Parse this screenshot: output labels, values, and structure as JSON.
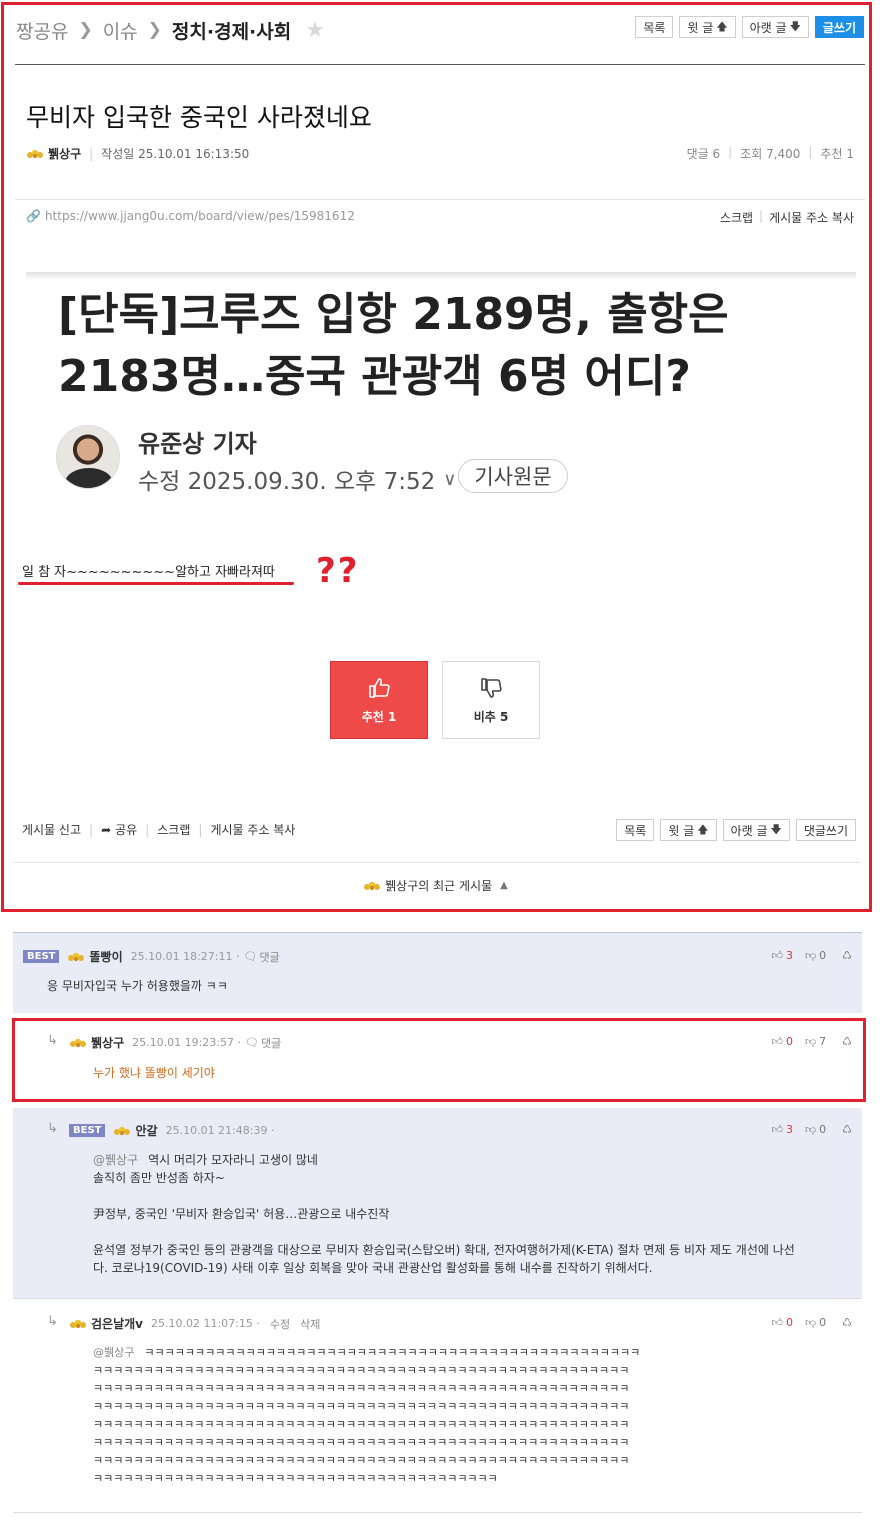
{
  "breadcrumb": [
    "짱공유",
    "이슈",
    "정치·경제·사회"
  ],
  "top_buttons": {
    "list": "목록",
    "prev": "윗 글",
    "next": "아랫 글",
    "write": "글쓰기"
  },
  "post": {
    "title": "무비자 입국한 중국인 사라졌네요",
    "author": "뷁상구",
    "date_label": "작성일 25.10.01 16:13:50",
    "comments": "댓글 6",
    "views": "조회 7,400",
    "recommends": "추천 1",
    "url": "https://www.jjang0u.com/board/view/pes/15981612",
    "scrap": "스크랩",
    "copy_url": "게시물 주소 복사",
    "body_text": "일 참 자~~~~~~~~~~알하고 자빠라져따",
    "annotation": "??"
  },
  "article_image": {
    "headline_1": "[단독]크루즈 입항 2189명, 출항은",
    "headline_2": "2183명…중국 관광객 6명 어디?",
    "reporter": "유준상 기자",
    "date": "수정 2025.09.30. 오후 7:52",
    "original": "기사원문"
  },
  "votes": {
    "up_label": "추천 1",
    "down_label": "비추 5"
  },
  "bottom_actions": {
    "report": "게시물 신고",
    "share": "공유",
    "scrap": "스크랩",
    "copy_url": "게시물 주소 복사"
  },
  "bottom_buttons": {
    "list": "목록",
    "prev": "윗 글",
    "next": "아랫 글",
    "write_comment": "댓글쓰기"
  },
  "recent_posts": "뷁상구의 최근 게시물",
  "colors": {
    "accent_red": "#e0202e",
    "write_blue": "#1e8fe8",
    "best_bg": "#e9ebf6",
    "best_badge": "#7f86c7"
  },
  "comments": [
    {
      "best": "BEST",
      "nick": "똘빵이",
      "time": "25.10.01 18:27:11 ·",
      "reply": "댓글",
      "up": "3",
      "down": "0",
      "text": "응 무비자입국 누가 허용했을까 ㅋㅋ"
    },
    {
      "nick": "뷁상구",
      "time": "25.10.01 19:23:57 ·",
      "reply": "댓글",
      "up": "0",
      "down": "7",
      "text": "누가 했냐 똘빵이 세기야"
    },
    {
      "best": "BEST",
      "nick": "안갈",
      "time": "25.10.01 21:48:39 ·",
      "up": "3",
      "down": "0",
      "mention": "@뷁상구",
      "line1": "역시 머리가 모자라니 고생이 많네",
      "line2": "솔직히 좀만 반성좀 하자~",
      "line3": "尹정부, 중국인 '무비자 환승입국' 허용…관광으로 내수진작",
      "line4": "윤석열 정부가 중국인 등의 관광객을 대상으로 무비자 환승입국(스탑오버) 확대, 전자여행허가제(K-ETA) 절차 면제 등 비자 제도 개선에 나선",
      "line5": "다. 코로나19(COVID-19) 사태 이후 일상 회복을 맞아 국내 관광산업 활성화를 통해 내수를 진작하기 위해서다."
    },
    {
      "nick": "검은날개v",
      "time": "25.10.02 11:07:15 ·",
      "edit": "수정",
      "delete": "삭제",
      "up": "0",
      "down": "0",
      "mention": "@뷁상구",
      "kk_lines": [
        "ㅋㅋㅋㅋㅋㅋㅋㅋㅋㅋㅋㅋㅋㅋㅋㅋㅋㅋㅋㅋㅋㅋㅋㅋㅋㅋㅋㅋㅋㅋㅋㅋㅋㅋㅋㅋㅋㅋㅋㅋㅋㅋㅋㅋㅋㅋㅋㅋㅋ",
        "ㅋㅋㅋㅋㅋㅋㅋㅋㅋㅋㅋㅋㅋㅋㅋㅋㅋㅋㅋㅋㅋㅋㅋㅋㅋㅋㅋㅋㅋㅋㅋㅋㅋㅋㅋㅋㅋㅋㅋㅋㅋㅋㅋㅋㅋㅋㅋㅋㅋㅋㅋㅋㅋ",
        "ㅋㅋㅋㅋㅋㅋㅋㅋㅋㅋㅋㅋㅋㅋㅋㅋㅋㅋㅋㅋㅋㅋㅋㅋㅋㅋㅋㅋㅋㅋㅋㅋㅋㅋㅋㅋㅋㅋㅋㅋㅋㅋㅋㅋㅋㅋㅋㅋㅋㅋㅋㅋㅋ",
        "ㅋㅋㅋㅋㅋㅋㅋㅋㅋㅋㅋㅋㅋㅋㅋㅋㅋㅋㅋㅋㅋㅋㅋㅋㅋㅋㅋㅋㅋㅋㅋㅋㅋㅋㅋㅋㅋㅋㅋㅋㅋㅋㅋㅋㅋㅋㅋㅋㅋㅋㅋㅋㅋ",
        "ㅋㅋㅋㅋㅋㅋㅋㅋㅋㅋㅋㅋㅋㅋㅋㅋㅋㅋㅋㅋㅋㅋㅋㅋㅋㅋㅋㅋㅋㅋㅋㅋㅋㅋㅋㅋㅋㅋㅋㅋㅋㅋㅋㅋㅋㅋㅋㅋㅋㅋㅋㅋㅋ",
        "ㅋㅋㅋㅋㅋㅋㅋㅋㅋㅋㅋㅋㅋㅋㅋㅋㅋㅋㅋㅋㅋㅋㅋㅋㅋㅋㅋㅋㅋㅋㅋㅋㅋㅋㅋㅋㅋㅋㅋㅋㅋㅋㅋㅋㅋㅋㅋㅋㅋㅋㅋㅋㅋ",
        "ㅋㅋㅋㅋㅋㅋㅋㅋㅋㅋㅋㅋㅋㅋㅋㅋㅋㅋㅋㅋㅋㅋㅋㅋㅋㅋㅋㅋㅋㅋㅋㅋㅋㅋㅋㅋㅋㅋㅋㅋㅋㅋㅋㅋㅋㅋㅋㅋㅋㅋㅋㅋㅋ",
        "ㅋㅋㅋㅋㅋㅋㅋㅋㅋㅋㅋㅋㅋㅋㅋㅋㅋㅋㅋㅋㅋㅋㅋㅋㅋㅋㅋㅋㅋㅋㅋㅋㅋㅋㅋㅋㅋㅋㅋㅋ"
      ]
    }
  ]
}
